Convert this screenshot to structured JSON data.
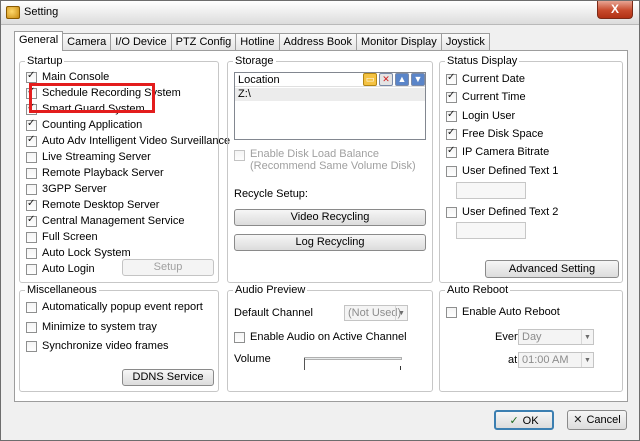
{
  "window": {
    "title": "Setting",
    "close_label": "X"
  },
  "tabs": [
    "General",
    "Camera",
    "I/O Device",
    "PTZ Config",
    "Hotline",
    "Address Book",
    "Monitor Display",
    "Joystick"
  ],
  "startup": {
    "title": "Startup",
    "items": [
      {
        "label": "Main Console",
        "checked": true
      },
      {
        "label": "Schedule Recording System",
        "checked": true
      },
      {
        "label": "Smart Guard System",
        "checked": true
      },
      {
        "label": "Counting Application",
        "checked": true
      },
      {
        "label": "Auto Adv Intelligent Video Surveillance",
        "checked": true
      },
      {
        "label": "Live Streaming Server",
        "checked": false
      },
      {
        "label": "Remote Playback Server",
        "checked": false
      },
      {
        "label": "3GPP Server",
        "checked": false
      },
      {
        "label": "Remote Desktop Server",
        "checked": true
      },
      {
        "label": "Central Management Service",
        "checked": true
      },
      {
        "label": "Full Screen",
        "checked": false
      },
      {
        "label": "Auto Lock System",
        "checked": false
      },
      {
        "label": "Auto Login",
        "checked": false
      }
    ],
    "setup_button": "Setup"
  },
  "storage": {
    "title": "Storage",
    "location_header": "Location",
    "locations": [
      "Z:\\"
    ],
    "disk_load_balance": "Enable Disk Load Balance (Recommend Same Volume Disk)",
    "recycle_label": "Recycle Setup:",
    "video_recycling": "Video Recycling",
    "log_recycling": "Log Recycling"
  },
  "status_display": {
    "title": "Status Display",
    "items": [
      {
        "label": "Current Date",
        "checked": true
      },
      {
        "label": "Current Time",
        "checked": true
      },
      {
        "label": "Login User",
        "checked": true
      },
      {
        "label": "Free Disk Space",
        "checked": true
      },
      {
        "label": "IP Camera Bitrate",
        "checked": true
      },
      {
        "label": "User Defined Text 1",
        "checked": false
      },
      {
        "label": "User Defined Text 2",
        "checked": false
      }
    ],
    "advanced_button": "Advanced Setting"
  },
  "misc": {
    "title": "Miscellaneous",
    "items": [
      {
        "label": "Automatically popup event report",
        "checked": false
      },
      {
        "label": "Minimize to system tray",
        "checked": false
      },
      {
        "label": "Synchronize video frames",
        "checked": false
      }
    ],
    "ddns_button": "DDNS Service"
  },
  "audio": {
    "title": "Audio Preview",
    "default_channel_label": "Default Channel",
    "default_channel_value": "(Not Used)",
    "enable_audio": "Enable Audio on Active Channel",
    "volume_label": "Volume",
    "volume_level": 0
  },
  "auto_reboot": {
    "title": "Auto Reboot",
    "enable_label": "Enable Auto Reboot",
    "every_label": "Every",
    "every_value": "Day",
    "at_label": "at",
    "at_value": "01:00 AM"
  },
  "footer": {
    "ok": "OK",
    "cancel": "Cancel"
  },
  "colors": {
    "highlight": "#e31d1d"
  }
}
